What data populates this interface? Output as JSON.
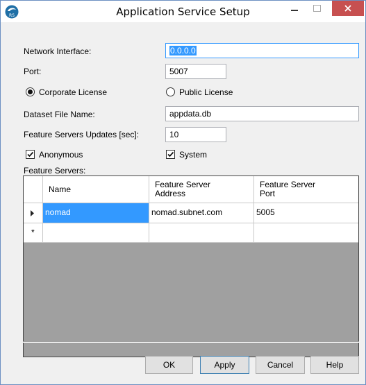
{
  "window": {
    "title": "Application Service Setup",
    "icon": "app-icon",
    "controls": {
      "minimize": "minimize-icon",
      "maximize": "maximize-icon",
      "close": "close-icon"
    },
    "accent": "#c75050"
  },
  "form": {
    "network_interface": {
      "label": "Network Interface:",
      "value": "0.0.0.0"
    },
    "port": {
      "label": "Port:",
      "value": "5007"
    },
    "license": {
      "corporate_label": "Corporate License",
      "public_label": "Public License",
      "selected": "Corporate License"
    },
    "dataset": {
      "label": "Dataset File Name:",
      "value": "appdata.db"
    },
    "updates": {
      "label": "Feature Servers Updates [sec]:",
      "value": "10"
    },
    "anonymous": {
      "label": "Anonymous",
      "checked": true
    },
    "system": {
      "label": "System",
      "checked": true
    },
    "feature_servers_label": "Feature Servers:"
  },
  "grid": {
    "headers": [
      "Name",
      "Feature Server\nAddress",
      "Feature Server\nPort"
    ],
    "header_lines": [
      [
        "Name"
      ],
      [
        "Feature Server",
        "Address"
      ],
      [
        "Feature Server",
        "Port"
      ]
    ],
    "rows": [
      {
        "name": "nomad",
        "address": "nomad.subnet.com",
        "port": "5005"
      }
    ],
    "new_row_marker": "*",
    "selection_color": "#3399ff"
  },
  "buttons": {
    "ok": "OK",
    "apply": "Apply",
    "cancel": "Cancel",
    "help": "Help"
  }
}
